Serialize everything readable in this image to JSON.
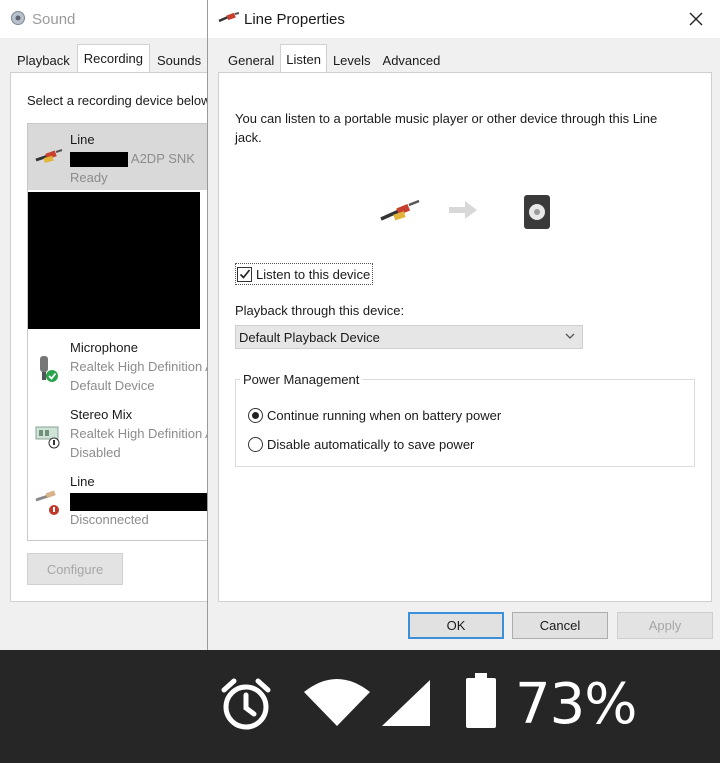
{
  "sound_window": {
    "title": "Sound",
    "tabs": [
      "Playback",
      "Recording",
      "Sounds"
    ],
    "active_tab": "Recording",
    "instruction": "Select a recording device below",
    "devices": [
      {
        "name": "Line",
        "desc": "A2DP SNK",
        "status": "Ready",
        "icon": "line-jack-icon"
      },
      {
        "name": "Microphone",
        "desc": "Realtek High Definition Audio",
        "status": "Default Device",
        "icon": "microphone-icon"
      },
      {
        "name": "Stereo Mix",
        "desc": "Realtek High Definition Audio",
        "status": "Disabled",
        "icon": "stereo-mix-icon"
      },
      {
        "name": "Line",
        "desc": "",
        "status": "Disconnected",
        "icon": "line-jack-icon"
      }
    ],
    "configure_label": "Configure"
  },
  "dialog": {
    "title": "Line Properties",
    "tabs": [
      "General",
      "Listen",
      "Levels",
      "Advanced"
    ],
    "active_tab": "Listen",
    "listen_description": "You can listen to a portable music player or other device through this Line jack.",
    "listen_checkbox": {
      "label": "Listen to this device",
      "checked": true
    },
    "playback_label": "Playback through this device:",
    "playback_selected": "Default Playback Device",
    "power_group": {
      "title": "Power Management",
      "options": [
        {
          "label": "Continue running when on battery power",
          "selected": true
        },
        {
          "label": "Disable automatically to save power",
          "selected": false
        }
      ]
    },
    "buttons": {
      "ok": "OK",
      "cancel": "Cancel",
      "apply": "Apply"
    }
  },
  "status_bar": {
    "battery_text": "73%",
    "icons": [
      "alarm-clock-icon",
      "wifi-icon",
      "cell-signal-icon",
      "battery-icon"
    ]
  },
  "colors": {
    "dialog_bg": "#f0f0f0",
    "panel_bg": "#ffffff",
    "ok_border": "#3c8fd9",
    "status_bar_bg": "#262626",
    "selected_row": "#d9d9d9"
  }
}
